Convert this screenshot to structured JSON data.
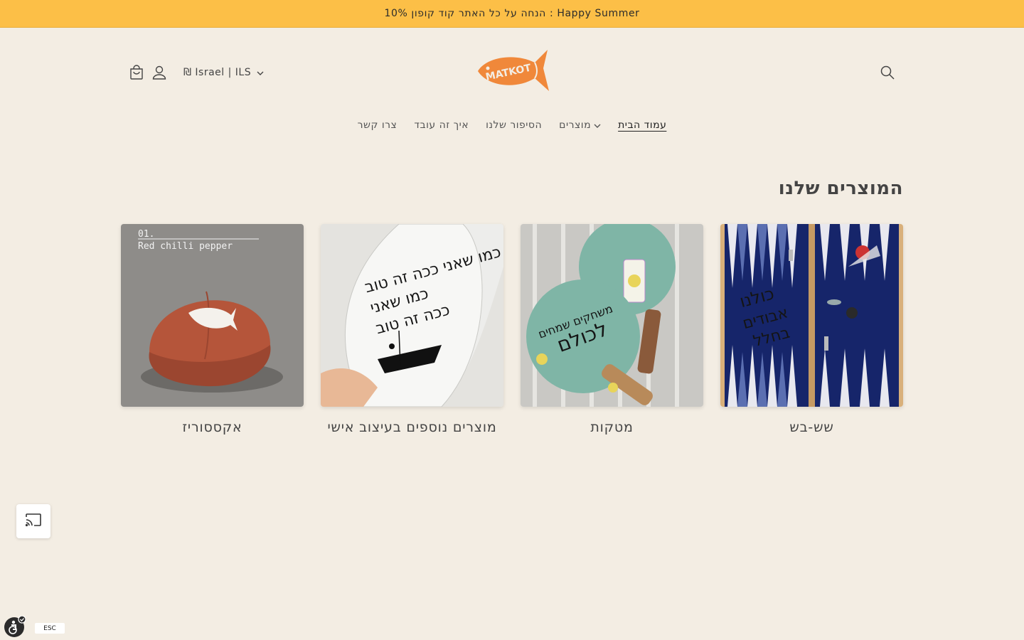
{
  "announcement": {
    "text": "10% הנחה על כל האתר קוד קופון : Happy Summer"
  },
  "header": {
    "currency_label": "₪ Israel | ILS",
    "logo_text": "MATKOT"
  },
  "nav": {
    "items": [
      {
        "label": "עמוד הבית",
        "active": true,
        "has_dropdown": false
      },
      {
        "label": "מוצרים",
        "active": false,
        "has_dropdown": true
      },
      {
        "label": "הסיפור שלנו",
        "active": false,
        "has_dropdown": false
      },
      {
        "label": "איך זה עובד",
        "active": false,
        "has_dropdown": false
      },
      {
        "label": "צרו קשר",
        "active": false,
        "has_dropdown": false
      }
    ]
  },
  "collections": {
    "title": "המוצרים שלנו",
    "items": [
      {
        "label": "שש-בש",
        "image": "backgammon-board"
      },
      {
        "label": "מטקות",
        "image": "paddles"
      },
      {
        "label": "מוצרים נוספים בעיצוב אישי",
        "image": "surfboard-sign",
        "sign_text": "בדיוק בדיוק כמו שאני ככה זה טוב"
      },
      {
        "label": "אקססוריז",
        "image": "red-cap",
        "caption_number": "01.",
        "caption_text": "Red chilli pepper"
      }
    ]
  },
  "widgets": {
    "esc_label": "ESC"
  },
  "colors": {
    "announcement": "#fcbf47",
    "background": "#f3ede3",
    "logo": "#f0883a"
  }
}
